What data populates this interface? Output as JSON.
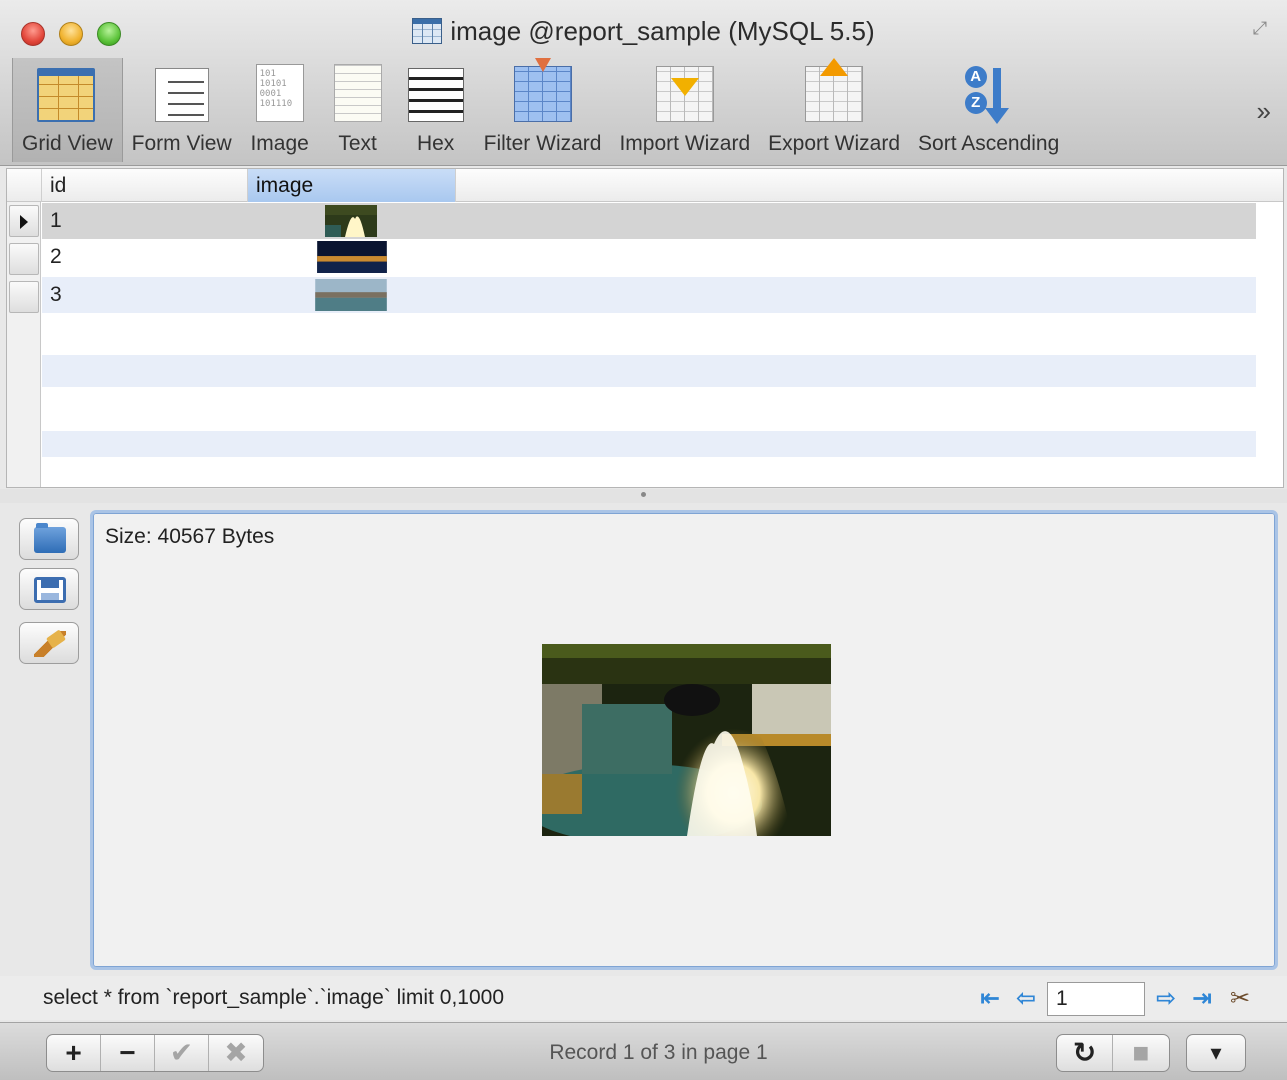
{
  "window": {
    "title": "image @report_sample (MySQL 5.5)"
  },
  "toolbar": {
    "items": [
      {
        "label": "Grid View",
        "icon": "grid-view-icon",
        "active": true
      },
      {
        "label": "Form View",
        "icon": "form-view-icon"
      },
      {
        "label": "Image",
        "icon": "image-view-icon"
      },
      {
        "label": "Text",
        "icon": "text-view-icon"
      },
      {
        "label": "Hex",
        "icon": "hex-view-icon"
      },
      {
        "label": "Filter Wizard",
        "icon": "filter-wizard-icon"
      },
      {
        "label": "Import Wizard",
        "icon": "import-wizard-icon"
      },
      {
        "label": "Export Wizard",
        "icon": "export-wizard-icon"
      },
      {
        "label": "Sort Ascending",
        "icon": "sort-ascending-icon"
      }
    ],
    "more": "»",
    "binary_glyph": "101\n10101\n0001\n101110"
  },
  "grid": {
    "columns": [
      "id",
      "image"
    ],
    "selected_column": "image",
    "rows": [
      {
        "id": "1",
        "thumb": "fountain-night",
        "current": true
      },
      {
        "id": "2",
        "thumb": "harbor-night"
      },
      {
        "id": "3",
        "thumb": "harbor-day"
      }
    ]
  },
  "viewer": {
    "size_label": "Size: 40567 Bytes",
    "side_buttons": [
      "open-folder-icon",
      "save-icon",
      "clear-brush-icon"
    ]
  },
  "sqlbar": {
    "query": "select * from `report_sample`.`image` limit 0,1000",
    "page": "1"
  },
  "bottombar": {
    "edit_buttons": [
      "+",
      "−",
      "✔",
      "✖"
    ],
    "record_info": "Record 1 of 3 in page 1",
    "refresh": "↻",
    "stop": "■",
    "menu": "▾"
  },
  "colors": {
    "accent": "#3d7cc9",
    "selected_column": "#a9c8ef",
    "selected_row": "#d4d4d4",
    "alt_row": "#e8eef9"
  }
}
